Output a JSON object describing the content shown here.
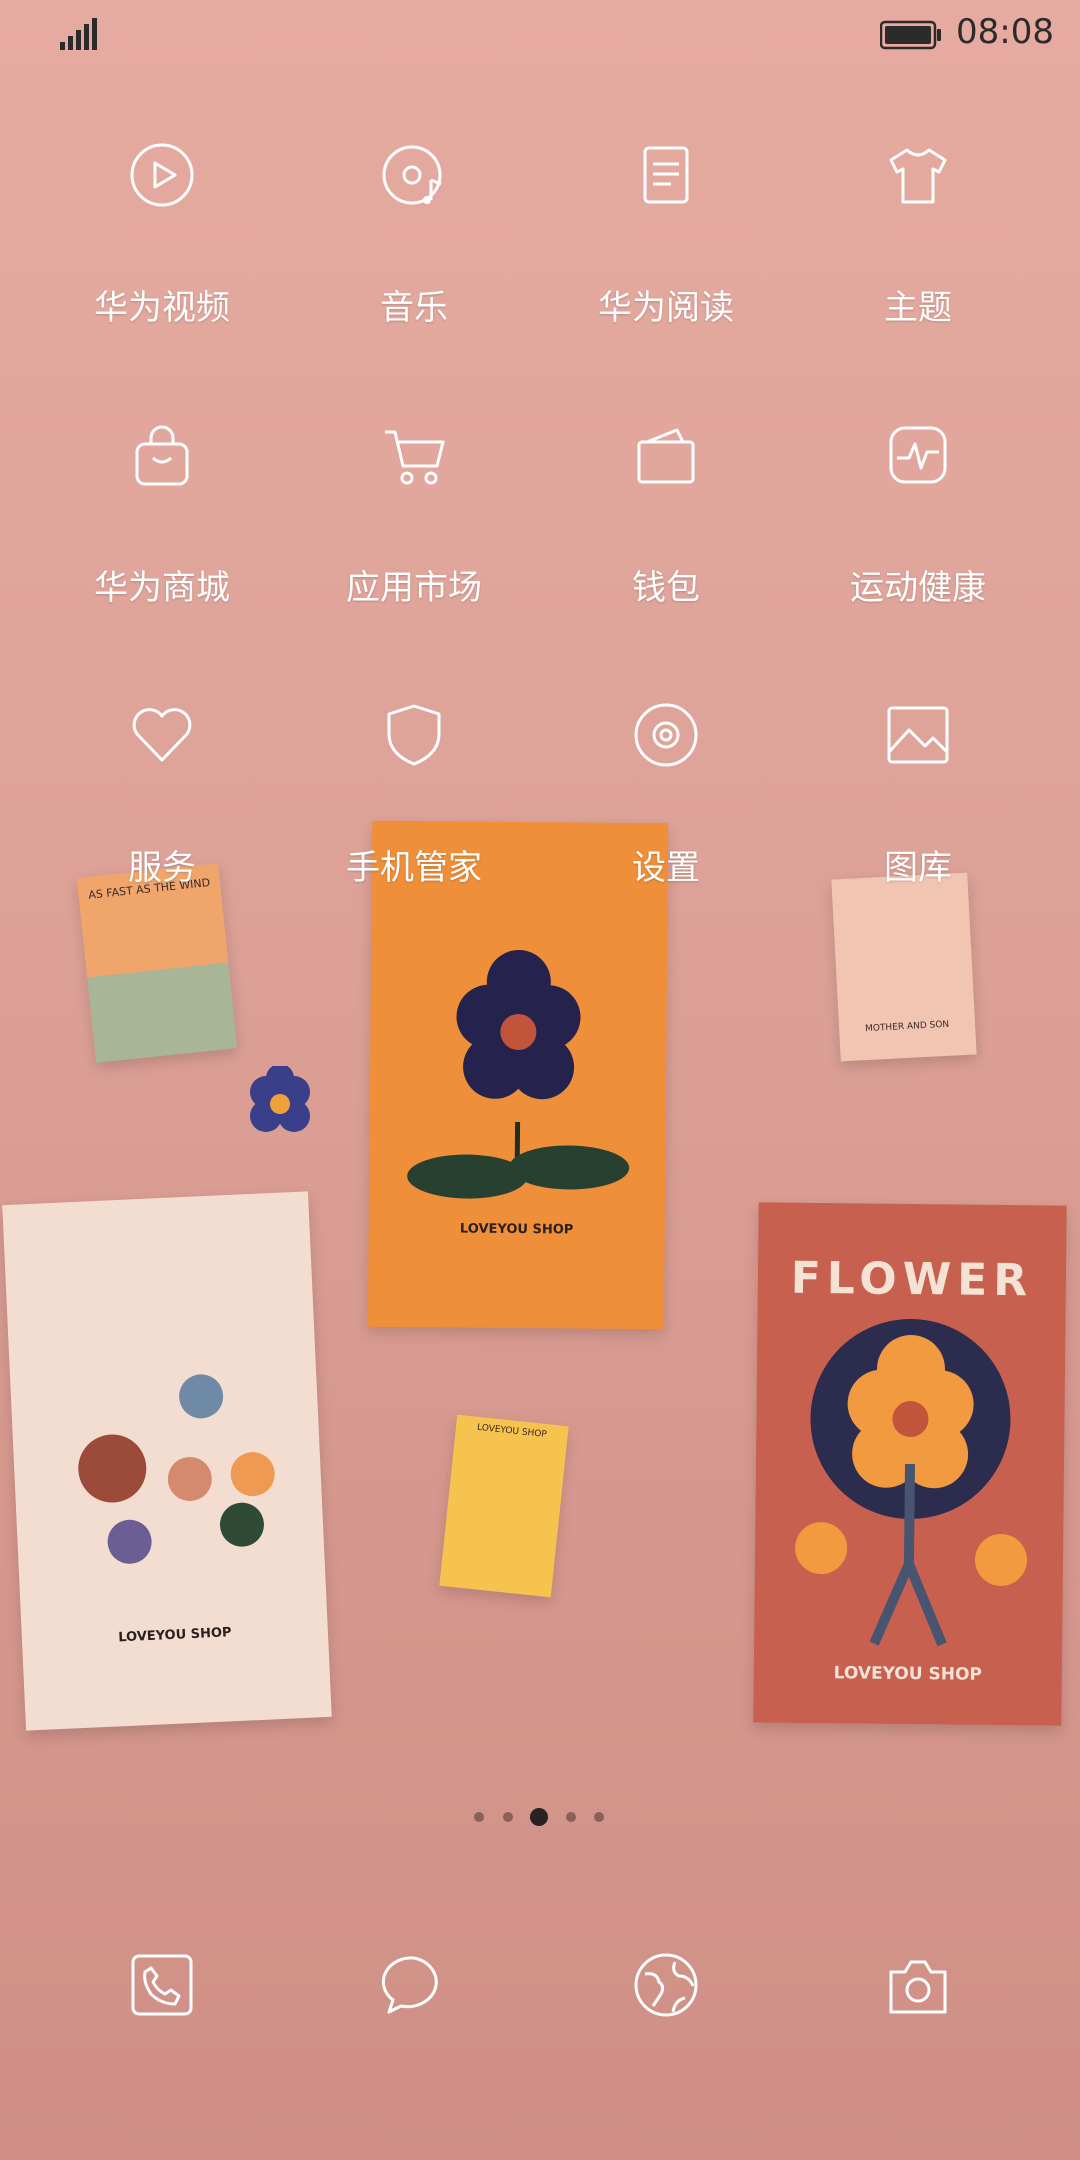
{
  "status_bar": {
    "time": "08:08",
    "signal_icon": "signal-icon",
    "battery_icon": "battery-icon"
  },
  "apps": [
    {
      "label": "华为视频",
      "icon": "play-icon"
    },
    {
      "label": "音乐",
      "icon": "music-icon"
    },
    {
      "label": "华为阅读",
      "icon": "book-icon"
    },
    {
      "label": "主题",
      "icon": "tshirt-icon"
    },
    {
      "label": "华为商城",
      "icon": "shopping-bag-icon"
    },
    {
      "label": "应用市场",
      "icon": "cart-icon"
    },
    {
      "label": "钱包",
      "icon": "wallet-icon"
    },
    {
      "label": "运动健康",
      "icon": "health-icon"
    },
    {
      "label": "服务",
      "icon": "heart-icon"
    },
    {
      "label": "手机管家",
      "icon": "shield-icon"
    },
    {
      "label": "设置",
      "icon": "gear-icon"
    },
    {
      "label": "图库",
      "icon": "gallery-icon"
    }
  ],
  "page_indicator": {
    "total": 5,
    "active": 3
  },
  "dock": [
    {
      "name": "phone",
      "icon": "phone-icon"
    },
    {
      "name": "messages",
      "icon": "message-icon"
    },
    {
      "name": "browser",
      "icon": "browser-icon"
    },
    {
      "name": "camera",
      "icon": "camera-icon"
    }
  ],
  "wallpaper": {
    "card_texts": [
      "AS FAST AS THE WIND",
      "LOVEYOU SHOP",
      "MOTHER AND SON",
      "LOVEYOU SHOP",
      "FLOWER",
      "LOVEYOU SHOP",
      "LOVEYOU SHOP"
    ],
    "colors": {
      "background": "#e0a59a",
      "orange_card": "#ef8f3a",
      "red_card": "#c8604f",
      "cream_card": "#f2ddd0"
    }
  }
}
